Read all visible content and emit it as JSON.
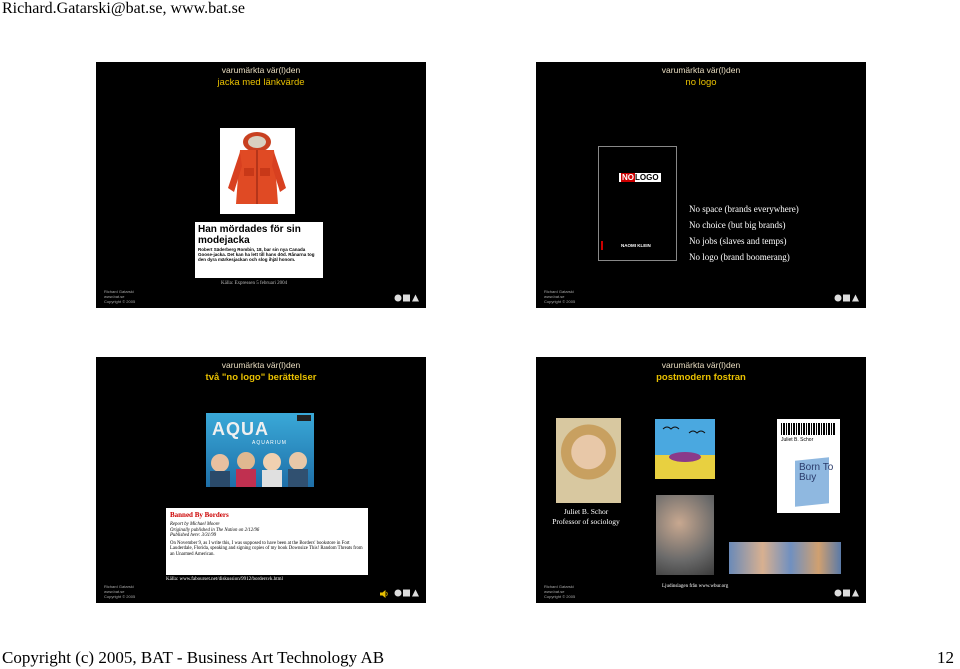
{
  "page": {
    "header": "Richard.Gatarski@bat.se, www.bat.se",
    "footer_left": "Copyright (c) 2005, BAT - Business Art Technology AB",
    "page_number": "12"
  },
  "slides": [
    {
      "top_title": "varumärkta vär(l)den",
      "subtitle": "jacka med länkvärde",
      "news_headline": "Han mördades för sin modejacka",
      "news_body": "Robert Säderberg Rombin, 18, bar sin nya Canada Goose-jacka. Det kan ha lett till hans död. Rånarna tog den dyra märkesjackan och slog ihjäl honom.",
      "source": "Källa: Expressen 5 februari 2004",
      "credit": [
        "Richard Gatarski",
        "www.bat.se",
        "Copyright © 2005"
      ]
    },
    {
      "top_title": "varumärkta vär(l)den",
      "subtitle": "no logo",
      "book_title_1": "NO",
      "book_title_2": "LOGO",
      "book_author": "NAOMI KLEIN",
      "lines": [
        "No space (brands everywhere)",
        "No choice (but big brands)",
        "No jobs (slaves and temps)",
        "No logo (brand boomerang)"
      ],
      "credit": [
        "Richard Gatarski",
        "www.bat.se",
        "Copyright © 2005"
      ]
    },
    {
      "top_title": "varumärkta vär(l)den",
      "subtitle": "två \"no logo\" berättelser",
      "album_title": "AQUA",
      "album_sub": "AQUARIUM",
      "report_headline": "Banned By Borders",
      "report_meta": [
        "Report by Michael Moore",
        "Originally published in The Nation on 2/12/96",
        "Published here: 3/31/99"
      ],
      "report_text": "On November 9, as I write this, I was supposed to have been at the Borders' bookstore in Fort Lauderdale, Florida, speaking and signing copies of my book Downsize This! Random Threats from an Unarmed American.",
      "source": "Källa: www.fabourset.net/diskussion/9912/bordersvk.html",
      "credit": [
        "Richard Gatarski",
        "www.bat.se",
        "Copyright © 2005"
      ]
    },
    {
      "top_title": "varumärkta vär(l)den",
      "subtitle": "postmodern fostran",
      "caption_name": "Juliet B. Schor",
      "caption_role": "Professor of sociology",
      "book_author": "Juliet B. Schor",
      "book_title": "Born To Buy",
      "source": "Ljudinslagen från www.wbur.org",
      "credit": [
        "Richard Gatarski",
        "www.bat.se",
        "Copyright © 2005"
      ]
    }
  ]
}
